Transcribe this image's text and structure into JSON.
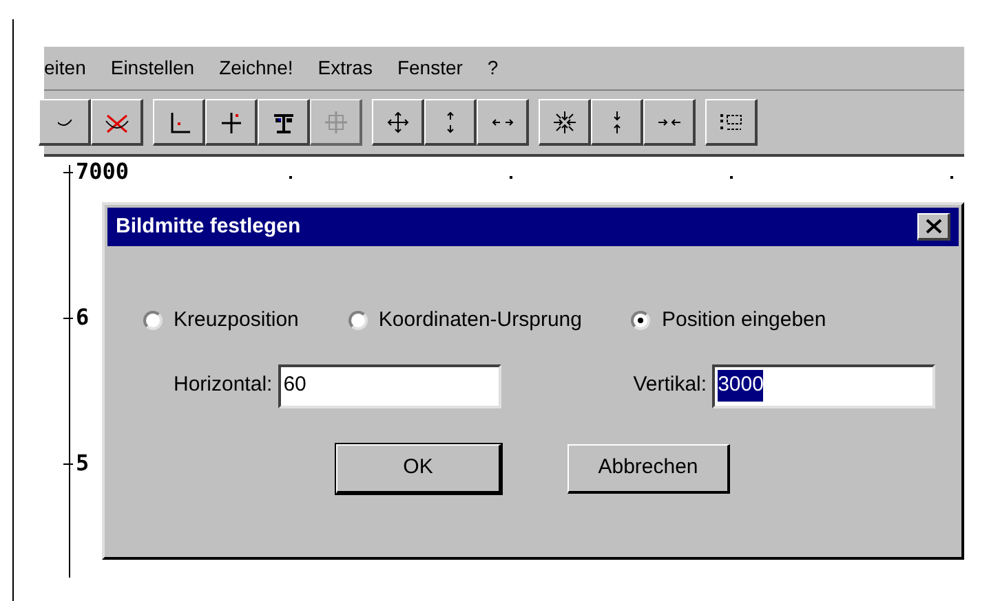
{
  "menu": [
    {
      "label": "eiten"
    },
    {
      "label": "Einstellen"
    },
    {
      "label": "Zeichne!"
    },
    {
      "label": "Extras"
    },
    {
      "label": "Fenster"
    },
    {
      "label": "?"
    }
  ],
  "toolbar": [
    [
      {
        "kind": "partial",
        "disabled": false
      },
      {
        "kind": "cross-curve",
        "disabled": false
      }
    ],
    [
      {
        "kind": "axis-corner",
        "disabled": false
      },
      {
        "kind": "plus-dot",
        "disabled": false
      },
      {
        "kind": "scale",
        "disabled": false
      },
      {
        "kind": "crosshair",
        "disabled": true
      }
    ],
    [
      {
        "kind": "move-all",
        "disabled": false
      },
      {
        "kind": "move-vertical",
        "disabled": false
      },
      {
        "kind": "move-horizontal",
        "disabled": false
      }
    ],
    [
      {
        "kind": "shrink-all",
        "disabled": false
      },
      {
        "kind": "shrink-vertical",
        "disabled": false
      },
      {
        "kind": "shrink-horizontal",
        "disabled": false
      }
    ],
    [
      {
        "kind": "list",
        "disabled": false
      }
    ]
  ],
  "axis": {
    "labels": [
      "7000",
      "6",
      "5"
    ]
  },
  "dialog": {
    "title": "Bildmitte festlegen",
    "options": [
      {
        "label": "Kreuzposition",
        "selected": false
      },
      {
        "label": "Koordinaten-Ursprung",
        "selected": false
      },
      {
        "label": "Position eingeben",
        "selected": true
      }
    ],
    "fields": [
      {
        "label": "Horizontal:",
        "value": "60",
        "selected": false
      },
      {
        "label": "Vertikal:",
        "value": "3000",
        "selected": true
      }
    ],
    "buttons": [
      {
        "label": "OK",
        "default": true
      },
      {
        "label": "Abbrechen",
        "default": false
      }
    ]
  }
}
